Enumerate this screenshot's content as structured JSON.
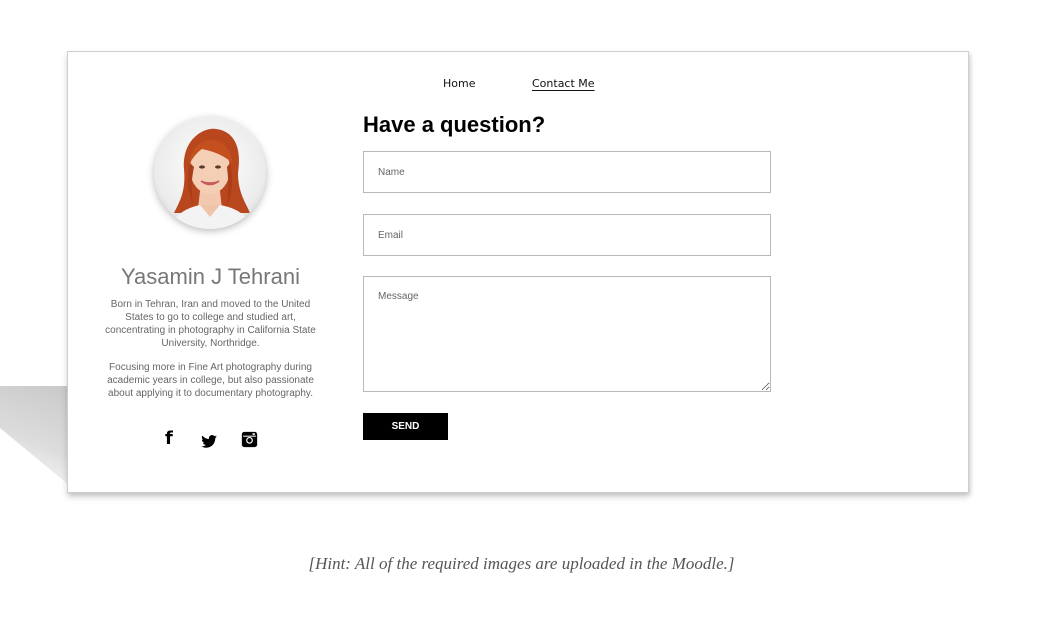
{
  "nav": {
    "home": "Home",
    "contact": "Contact Me"
  },
  "profile": {
    "name": "Yasamin J Tehrani",
    "bio": [
      "Born in Tehran, Iran and moved to the United States to go to college and studied art, concentrating in photography in California State University, Northridge.",
      "Focusing more in Fine Art photography during academic years in college, but also passionate about applying it to documentary photography."
    ],
    "social_icons": [
      "facebook-icon",
      "twitter-icon",
      "instagram-icon"
    ]
  },
  "form": {
    "heading": "Have a question?",
    "name_placeholder": "Name",
    "email_placeholder": "Email",
    "message_placeholder": "Message",
    "send_label": "SEND"
  },
  "hint": "[Hint: All of the required images are uploaded in the Moodle.]",
  "colors": {
    "button_bg": "#000000",
    "name_text": "#777777",
    "bio_text": "#666666"
  }
}
